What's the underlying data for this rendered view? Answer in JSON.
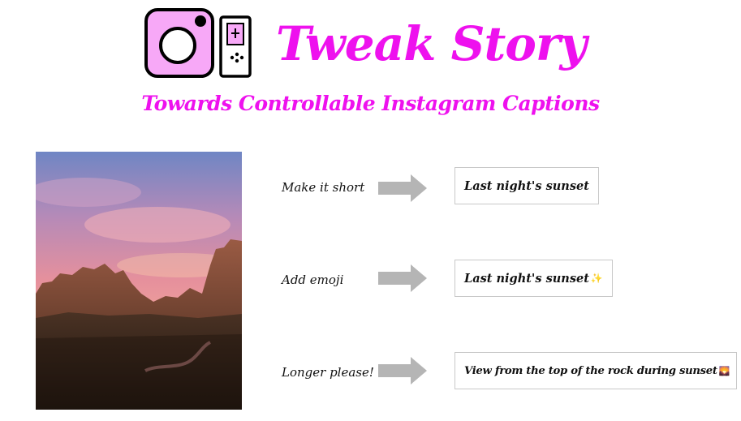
{
  "header": {
    "title": "Tweak Story",
    "subtitle": "Towards Controllable Instagram Captions"
  },
  "rows": [
    {
      "instruction": "Make it short",
      "caption": "Last night's sunset",
      "emoji": ""
    },
    {
      "instruction": "Add emoji",
      "caption": "Last night's sunset",
      "emoji": "✨"
    },
    {
      "instruction": "Longer please!",
      "caption": "View from the top of the rock during sunset",
      "emoji": "🌄"
    }
  ],
  "colors": {
    "accent": "#ee11ee",
    "logo_fill": "#f7a8f7",
    "arrow": "#b5b5b5"
  }
}
